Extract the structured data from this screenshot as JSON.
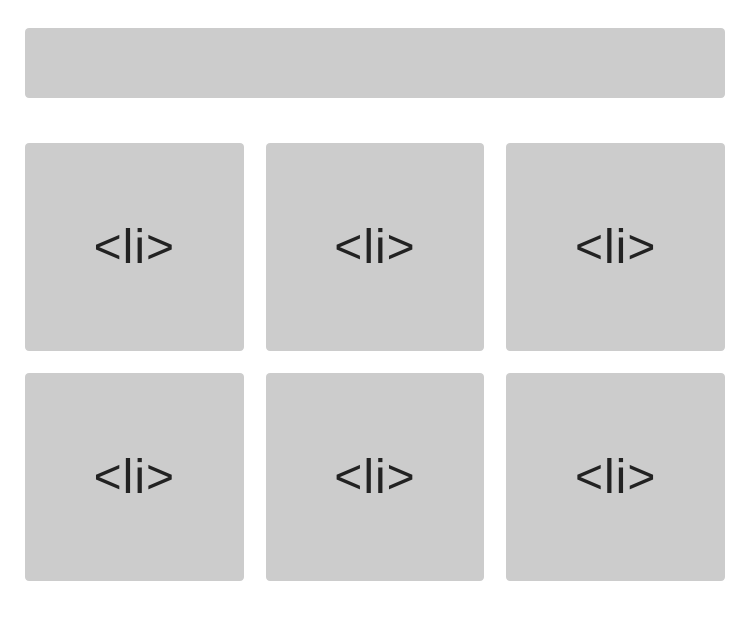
{
  "grid": {
    "items": [
      {
        "label": "<li>"
      },
      {
        "label": "<li>"
      },
      {
        "label": "<li>"
      },
      {
        "label": "<li>"
      },
      {
        "label": "<li>"
      },
      {
        "label": "<li>"
      }
    ]
  }
}
